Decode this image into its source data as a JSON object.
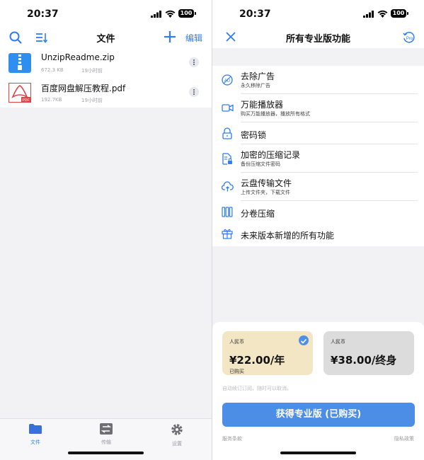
{
  "status": {
    "time": "20:37",
    "battery": "100"
  },
  "files_screen": {
    "title": "文件",
    "edit_label": "编辑",
    "files": [
      {
        "name": "UnzipReadme.zip",
        "size": "672.3 KB",
        "time": "19小时前",
        "icon": "zip-file-icon"
      },
      {
        "name": "百度网盘解压教程.pdf",
        "size": "192.7KB",
        "time": "19小时前",
        "icon": "pdf-file-icon"
      }
    ],
    "tabs": [
      {
        "label": "文件",
        "icon": "folder-icon",
        "active": true
      },
      {
        "label": "传输",
        "icon": "transfer-icon",
        "active": false
      },
      {
        "label": "设置",
        "icon": "gear-icon",
        "active": false
      }
    ]
  },
  "pro_screen": {
    "title": "所有专业版功能",
    "features": [
      {
        "title": "去除广告",
        "subtitle": "永久移除广告",
        "icon": "no-ads-icon"
      },
      {
        "title": "万能播放器",
        "subtitle": "购买万能播放器，播放所有格式",
        "icon": "video-player-icon"
      },
      {
        "title": "密码锁",
        "subtitle": "",
        "icon": "padlock-icon"
      },
      {
        "title": "加密的压缩记录",
        "subtitle": "备份压缩文件密码",
        "icon": "encrypted-file-icon"
      },
      {
        "title": "云盘传输文件",
        "subtitle": "上传文件夹，下载文件",
        "icon": "cloud-upload-icon"
      },
      {
        "title": "分卷压缩",
        "subtitle": "",
        "icon": "split-volume-icon"
      },
      {
        "title": "未来版本新增的所有功能",
        "subtitle": "",
        "icon": "gift-icon"
      }
    ],
    "prices": [
      {
        "currency": "人民币",
        "amount": "¥22.00/年",
        "status": "已购买",
        "selected": true
      },
      {
        "currency": "人民币",
        "amount": "¥38.00/终身",
        "status": "",
        "selected": false
      }
    ],
    "note": "自动续订订阅，随时可以取消。",
    "buy_button": "获得专业版 (已购买)",
    "terms_link": "服务条款",
    "privacy_link": "隐私政策"
  },
  "colors": {
    "accent": "#2f7cf6",
    "selected_price_bg": "#f3e6c4",
    "unselected_price_bg": "#dcdcdc",
    "buy_button": "#4c8de6"
  }
}
